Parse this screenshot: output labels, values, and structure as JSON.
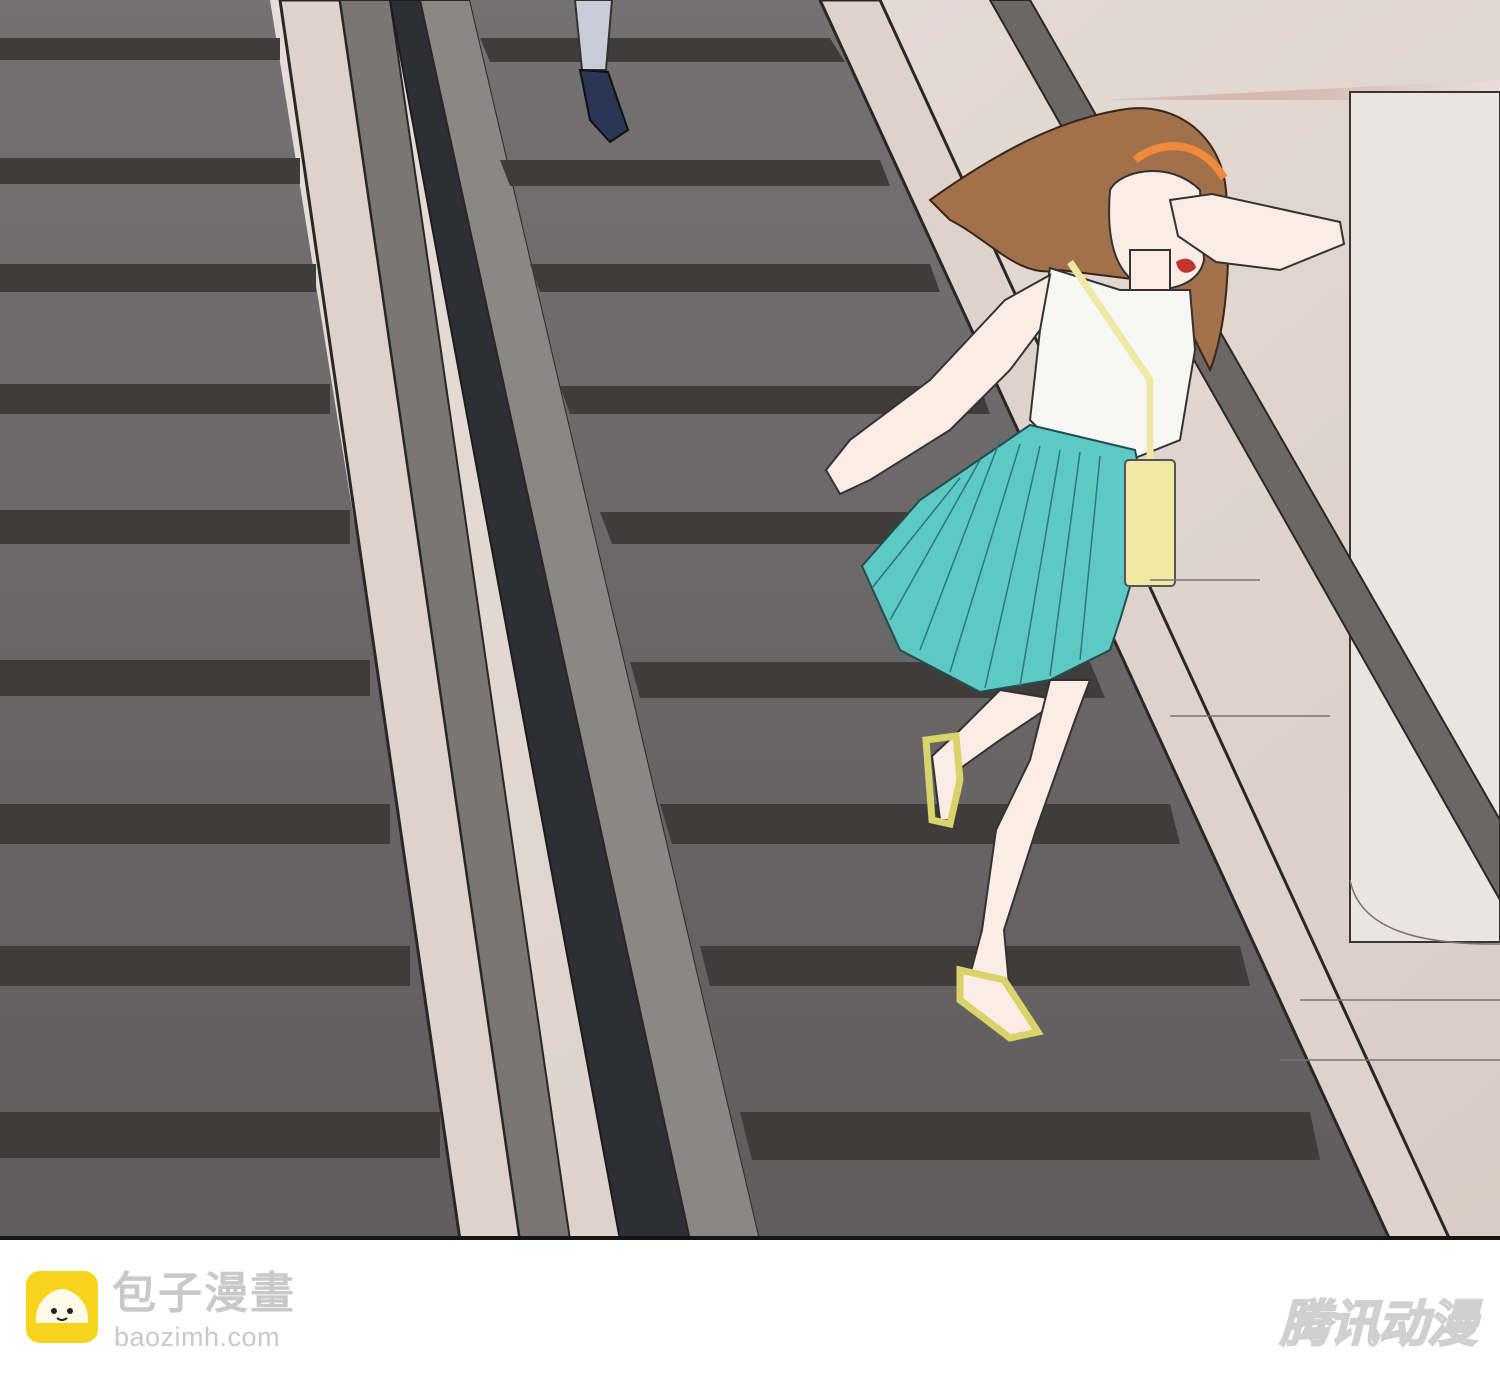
{
  "footer": {
    "brand_name": "包子漫畫",
    "brand_url": "baozimh.com",
    "publisher_mark": "腾讯动漫"
  },
  "illustration": {
    "scene": "escalator",
    "colors": {
      "step_face": "#6f6d6e",
      "step_edge": "#3e3b3c",
      "handrail": "#333333",
      "balustrade": "#ded3cc",
      "skirt": "#5cc9c6",
      "shirt": "#f7f7f5",
      "hair": "#a0714b",
      "bag": "#efe9a4",
      "headband": "#f08a3a",
      "skin": "#fbece5"
    }
  }
}
